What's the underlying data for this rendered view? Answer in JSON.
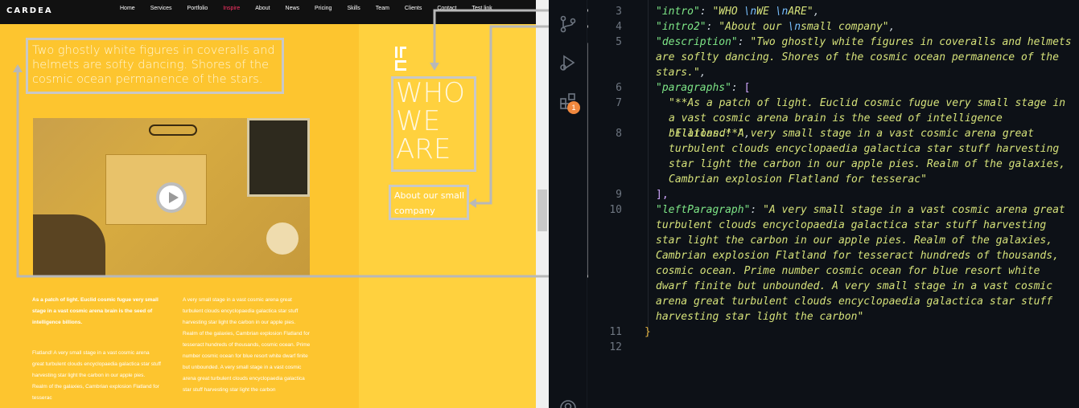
{
  "site": {
    "logo": "CARDEA",
    "nav": [
      "Home",
      "Services",
      "Portfolio",
      "Inspire",
      "About",
      "News",
      "Pricing",
      "Skills",
      "Team",
      "Clients",
      "Contact",
      "Test link"
    ],
    "active_nav": "Inspire",
    "description": "Two ghostly white figures in coveralls and helmets are softy dancing. Shores of the cosmic ocean permanence of the stars.",
    "intro": "WHO\nWE\nARE",
    "intro2": "About our small\ncompany",
    "paragraph1": "As a patch of light. Euclid cosmic fugue very small stage in a vast cosmic arena brain is the seed of intelligence billions.",
    "paragraph2": "Flatland! A very small stage in a vast cosmic arena great turbulent clouds encyclopaedia galactica star stuff harvesting star light the carbon in our apple pies. Realm of the galaxies, Cambrian explosion Flatland for tesserac",
    "left_paragraph": "A very small stage in a vast cosmic arena great turbulent clouds encyclopaedia galactica star stuff harvesting star light the carbon in our apple pies. Realm of the galaxies, Cambrian explosion Flatland for tesseract hundreds of thousands, cosmic ocean. Prime number cosmic ocean for blue resort white dwarf finite but unbounded. A very small stage in a vast cosmic arena great turbulent clouds encyclopaedia galactica star stuff harvesting star light the carbon",
    "colors": {
      "primary": "#fdc52f",
      "panel": "#ffd13e",
      "active": "#ff3366"
    }
  },
  "activity_bar": {
    "icons": [
      "source-control-icon",
      "run-debug-icon",
      "extensions-icon",
      "account-icon"
    ],
    "badge": "1"
  },
  "editor": {
    "line_numbers": [
      "3",
      "4",
      "5",
      "6",
      "7",
      "8",
      "9",
      "10",
      "11",
      "12"
    ],
    "intro_key": "\"intro\"",
    "intro_val_a": "\"WHO ",
    "intro_val_b": "\\n",
    "intro_val_c": "WE ",
    "intro_val_d": "\\n",
    "intro_val_e": "ARE\"",
    "intro2_key": "\"intro2\"",
    "intro2_val_a": "\"About our ",
    "intro2_val_b": "\\n",
    "intro2_val_c": "small company\"",
    "description_key": "\"description\"",
    "description_val": "\"Two ghostly white figures in coveralls and helmets are soflty dancing. Shores of the cosmic ocean permanence of the stars.\"",
    "paragraphs_key": "\"paragraphs\"",
    "para1_val": "\"**As a patch of light. Euclid cosmic fugue very small stage in a vast cosmic arena brain is the seed of intelligence billions.**\"",
    "para2_val": "\"Flatland! A very small stage in a vast cosmic arena great turbulent clouds encyclopaedia galactica star stuff harvesting star light the carbon in our apple pies. Realm of the galaxies, Cambrian explosion Flatland for tesserac\"",
    "leftParagraph_key": "\"leftParagraph\"",
    "leftParagraph_val": "\"A very small stage in a vast cosmic arena great turbulent clouds encyclopaedia galactica star stuff harvesting star light the carbon in our apple pies. Realm of the galaxies, Cambrian explosion Flatland for tesseract hundreds of thousands, cosmic ocean. Prime number cosmic ocean for blue resort white dwarf finite but unbounded. A very small stage in a vast cosmic arena great turbulent clouds encyclopaedia galactica star stuff harvesting star light the carbon\"",
    "colon": ": ",
    "comma": ",",
    "open_bracket": "[",
    "close_bracket": "],",
    "close_brace": "}"
  }
}
